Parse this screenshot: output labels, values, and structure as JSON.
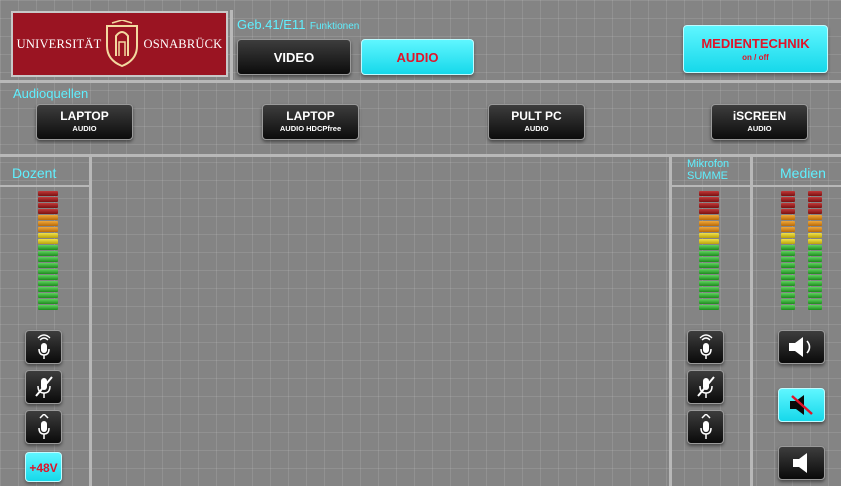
{
  "header": {
    "logo": {
      "left_text": "UNIVERSITÄT",
      "right_text": "OSNABRÜCK",
      "icon": "university-crest-icon"
    },
    "room": "Geb.41/E11",
    "room_sub": "Funktionen",
    "tabs": [
      {
        "label": "VIDEO",
        "active": false
      },
      {
        "label": "AUDIO",
        "active": true
      }
    ],
    "medientechnik": {
      "label": "MEDIENTECHNIK",
      "sub": "on / off",
      "color": "#e0142a"
    }
  },
  "audioquellen": {
    "title": "Audioquellen",
    "sources": [
      {
        "label": "LAPTOP",
        "sub": "AUDIO"
      },
      {
        "label": "LAPTOP",
        "sub": "AUDIO HDCPfree"
      },
      {
        "label": "PULT PC",
        "sub": "AUDIO"
      },
      {
        "label": "iSCREEN",
        "sub": "AUDIO"
      }
    ]
  },
  "dozent": {
    "title": "Dozent",
    "meter_level": 0.0,
    "buttons": [
      {
        "icon": "microphone-wireless-icon"
      },
      {
        "icon": "microphone-muted-icon"
      },
      {
        "icon": "microphone-down-icon"
      }
    ],
    "phantom_label": "+48V"
  },
  "mikrofon": {
    "title_line1": "Mikrofon",
    "title_line2": "SUMME",
    "meter_level": 0.0,
    "buttons": [
      {
        "icon": "microphone-wireless-icon"
      },
      {
        "icon": "microphone-muted-icon"
      },
      {
        "icon": "microphone-down-icon"
      }
    ]
  },
  "medien": {
    "title": "Medien",
    "meter_levels": [
      0.0,
      0.0
    ],
    "buttons": [
      {
        "icon": "volume-up-icon"
      },
      {
        "icon": "volume-mute-icon",
        "active": true
      },
      {
        "icon": "volume-down-icon"
      }
    ]
  },
  "colors": {
    "accent": "#5ff0ff",
    "brand": "#9a1422",
    "background": "#848484"
  }
}
